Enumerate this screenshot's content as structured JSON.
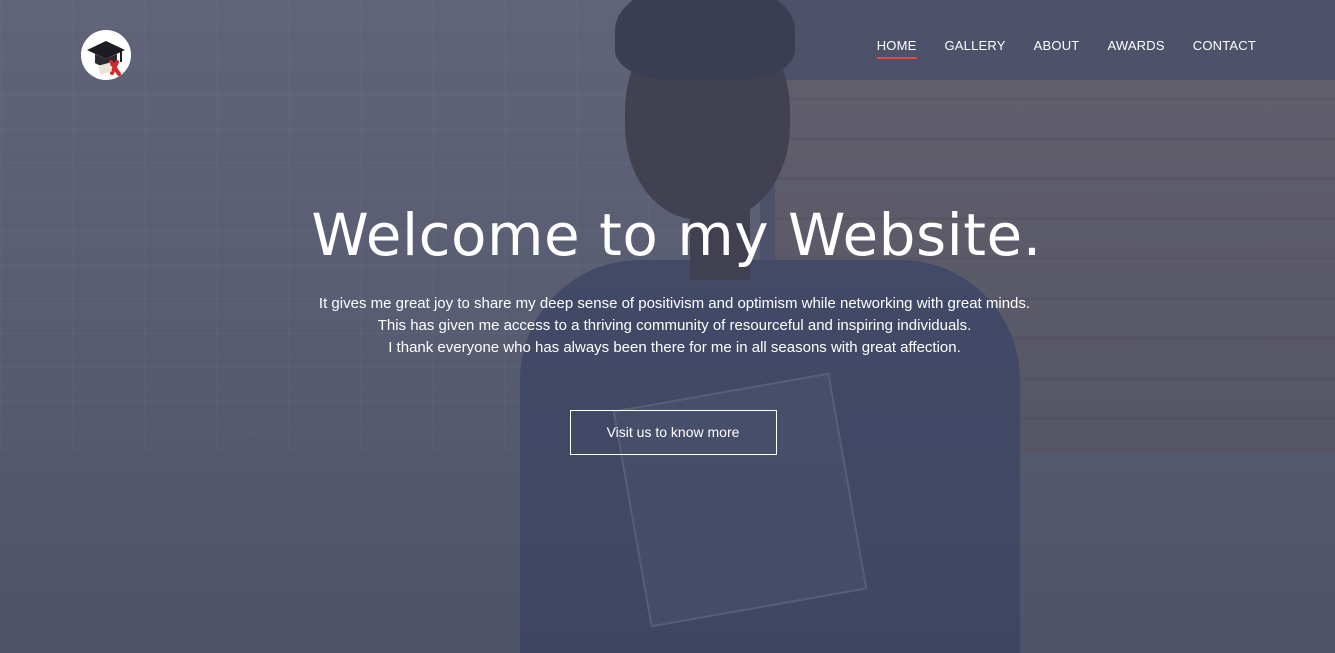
{
  "nav": {
    "items": [
      {
        "label": "HOME",
        "active": true
      },
      {
        "label": "GALLERY",
        "active": false
      },
      {
        "label": "ABOUT",
        "active": false
      },
      {
        "label": "AWARDS",
        "active": false
      },
      {
        "label": "CONTACT",
        "active": false
      }
    ],
    "active_underline_color": "#e8473b"
  },
  "logo": {
    "icon": "graduation-cap-icon"
  },
  "hero": {
    "title": "Welcome to my Website.",
    "lines": [
      "It gives me great joy to share my deep sense of positivism and optimism while networking with great minds.",
      "This has given me access to a thriving community of resourceful and inspiring individuals.",
      "I thank everyone who has always been there for me in all seasons with great affection."
    ],
    "cta_label": "Visit us to know more"
  },
  "colors": {
    "overlay": "#464a64",
    "text": "#ffffff",
    "accent": "#e8473b"
  }
}
